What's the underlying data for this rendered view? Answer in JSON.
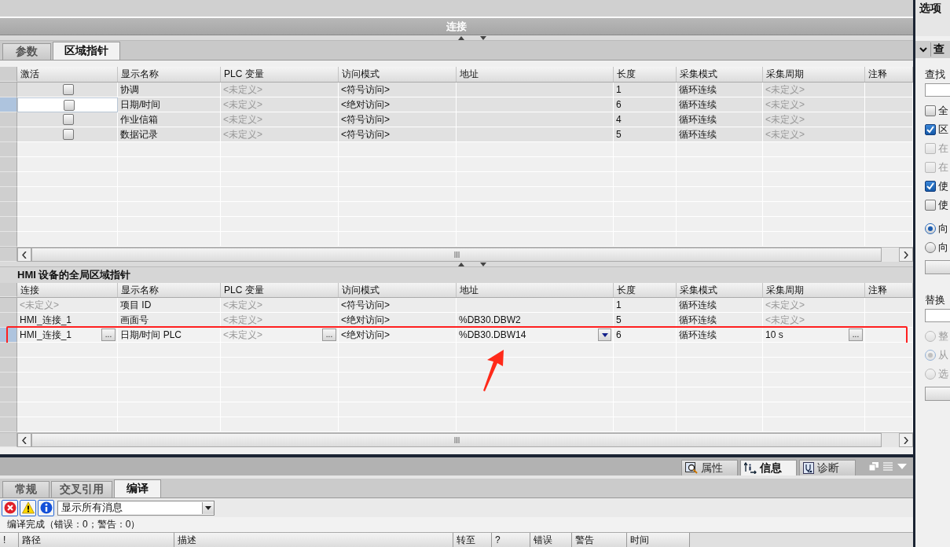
{
  "title_bar": {
    "title": "连接"
  },
  "tabs": [
    {
      "label": "参数",
      "selected": false
    },
    {
      "label": "区域指针",
      "selected": true
    }
  ],
  "area_pointers": {
    "columns": [
      "激活",
      "显示名称",
      "PLC 变量",
      "访问模式",
      "地址",
      "长度",
      "采集模式",
      "采集周期",
      "注释"
    ],
    "rows": [
      {
        "focused": false,
        "active": false,
        "name": "协调",
        "plc_tag": {
          "text": "<未定义>",
          "dim": true
        },
        "access": "<符号访问>",
        "length": "1",
        "mode": "循环连续",
        "period": {
          "text": "<未定义>",
          "dim": true
        }
      },
      {
        "focused": true,
        "active": false,
        "name": "日期/时间",
        "plc_tag": {
          "text": "<未定义>",
          "dim": true
        },
        "access": "<绝对访问>",
        "length": "6",
        "mode": "循环连续",
        "period": {
          "text": "<未定义>",
          "dim": true
        }
      },
      {
        "focused": false,
        "active": false,
        "name": "作业信箱",
        "plc_tag": {
          "text": "<未定义>",
          "dim": true
        },
        "access": "<符号访问>",
        "length": "4",
        "mode": "循环连续",
        "period": {
          "text": "<未定义>",
          "dim": true
        }
      },
      {
        "focused": false,
        "active": false,
        "name": "数据记录",
        "plc_tag": {
          "text": "<未定义>",
          "dim": true
        },
        "access": "<符号访问>",
        "length": "5",
        "mode": "循环连续",
        "period": {
          "text": "<未定义>",
          "dim": true
        }
      }
    ]
  },
  "global_pointers": {
    "title": "HMI 设备的全局区域指针",
    "columns": [
      "连接",
      "显示名称",
      "PLC 变量",
      "访问模式",
      "地址",
      "长度",
      "采集模式",
      "采集周期",
      "注释"
    ],
    "rows": [
      {
        "focused": false,
        "annotated": false,
        "connection": {
          "text": "<未定义>",
          "dim": true
        },
        "name": "项目 ID",
        "plc_tag": {
          "text": "<未定义>",
          "dim": true
        },
        "access": "<符号访问>",
        "length": "1",
        "mode": "循环连续",
        "period": {
          "text": "<未定义>",
          "dim": true
        }
      },
      {
        "focused": false,
        "annotated": false,
        "connection": "HMI_连接_1",
        "name": "画面号",
        "plc_tag": {
          "text": "<未定义>",
          "dim": true
        },
        "access": "<绝对访问>",
        "address": "%DB30.DBW2",
        "length": "5",
        "mode": "循环连续",
        "period": {
          "text": "<未定义>",
          "dim": true
        }
      },
      {
        "focused": true,
        "annotated": true,
        "connection": {
          "text": "HMI_连接_1",
          "button": "..."
        },
        "name": "日期/时间 PLC",
        "plc_tag": {
          "text": "<未定义>",
          "dim": true,
          "button": "..."
        },
        "access": "<绝对访问>",
        "address": {
          "text": "%DB30.DBW14",
          "dropdown": true
        },
        "length": "6",
        "mode": "循环连续",
        "period": {
          "text": "10 s",
          "button": "..."
        }
      }
    ]
  },
  "inspector_tabs": [
    {
      "label": "属性",
      "kind": "properties",
      "selected": false
    },
    {
      "label": "信息",
      "kind": "info",
      "selected": true
    },
    {
      "label": "诊断",
      "kind": "diagnostics",
      "selected": false
    }
  ],
  "message_tabs": [
    {
      "label": "常规",
      "selected": false
    },
    {
      "label": "交叉引用",
      "selected": false
    },
    {
      "label": "编译",
      "selected": true
    }
  ],
  "message_filter": {
    "value": "显示所有消息"
  },
  "status": "编译完成（错误：0；警告：0）",
  "message_columns": [
    "!",
    "路径",
    "描述",
    "转至",
    "?",
    "错误",
    "警告",
    "时间"
  ],
  "options_panel": {
    "title": "选项",
    "section": "查",
    "find_label": "查找",
    "find_options": [
      {
        "kind": "checkbox",
        "label": "全",
        "checked": false,
        "disabled": false
      },
      {
        "kind": "checkbox",
        "label": "区",
        "checked": true,
        "disabled": false
      },
      {
        "kind": "checkbox",
        "label": "在",
        "checked": false,
        "disabled": true
      },
      {
        "kind": "checkbox",
        "label": "在",
        "checked": false,
        "disabled": true
      },
      {
        "kind": "checkbox",
        "label": "使",
        "checked": true,
        "disabled": false
      },
      {
        "kind": "checkbox",
        "label": "使",
        "checked": false,
        "disabled": false
      },
      {
        "kind": "radio",
        "label": "向",
        "checked": true,
        "disabled": false
      },
      {
        "kind": "radio",
        "label": "向",
        "checked": false,
        "disabled": false
      }
    ],
    "replace_label": "替换",
    "replace_options": [
      {
        "kind": "radio",
        "label": "整",
        "checked": false,
        "disabled": true
      },
      {
        "kind": "radio",
        "label": "从",
        "checked": true,
        "disabled": true
      },
      {
        "kind": "radio",
        "label": "选",
        "checked": false,
        "disabled": true
      }
    ]
  }
}
